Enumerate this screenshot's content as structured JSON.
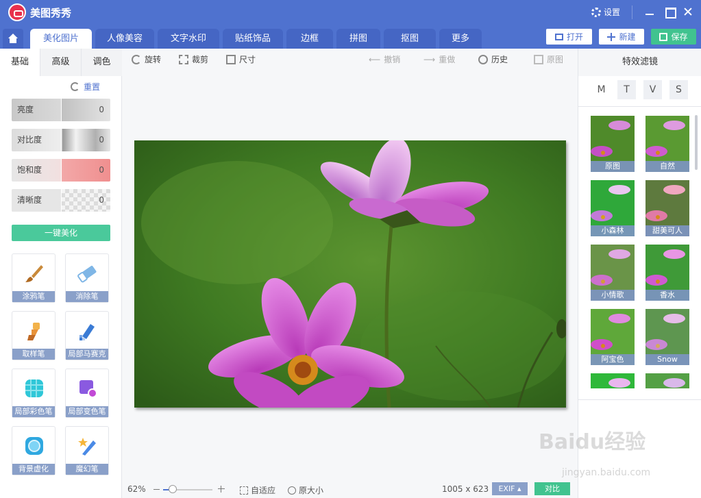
{
  "app": {
    "title": "美图秀秀"
  },
  "window": {
    "settings_label": "设置"
  },
  "tabs": [
    "美化图片",
    "人像美容",
    "文字水印",
    "贴纸饰品",
    "边框",
    "拼图",
    "抠图",
    "更多"
  ],
  "actions": {
    "open": "打开",
    "new": "新建",
    "save": "保存"
  },
  "left_panel": {
    "subtabs": [
      "基础",
      "高级",
      "调色"
    ],
    "reset_label": "重置",
    "sliders": [
      {
        "label": "亮度",
        "value": "0"
      },
      {
        "label": "对比度",
        "value": "0"
      },
      {
        "label": "饱和度",
        "value": "0"
      },
      {
        "label": "清晰度",
        "value": "0"
      }
    ],
    "one_click": "一键美化",
    "tools": [
      "涂鸦笔",
      "消除笔",
      "取样笔",
      "局部马赛克",
      "局部彩色笔",
      "局部变色笔",
      "背景虚化",
      "魔幻笔"
    ]
  },
  "toolbar": {
    "rotate": "旋转",
    "crop": "裁剪",
    "size": "尺寸",
    "undo": "撤销",
    "redo": "重做",
    "history": "历史",
    "original": "原图"
  },
  "status": {
    "zoom": "62%",
    "fit": "自适应",
    "actual": "原大小",
    "dimensions": "1005 x 623",
    "exif": "EXIF ▴",
    "compare": "对比"
  },
  "right_panel": {
    "title": "特效滤镜",
    "categories": [
      "M",
      "T",
      "V",
      "S"
    ],
    "filters": [
      "原图",
      "自然",
      "小森林",
      "甜美可人",
      "小情歌",
      "香水",
      "阿宝色",
      "Snow"
    ]
  },
  "watermark": {
    "logo": "Baidu经验",
    "url": "jingyan.baidu.com"
  }
}
